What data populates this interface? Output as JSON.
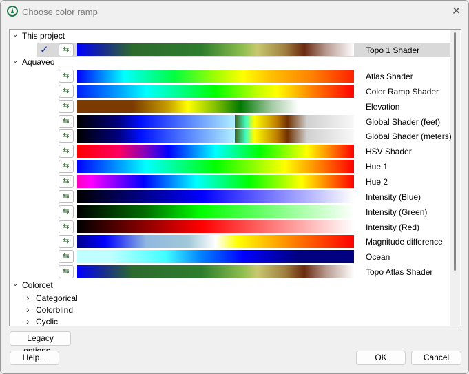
{
  "window": {
    "title": "Choose color ramp",
    "close_icon": "close-icon"
  },
  "tree": {
    "project": {
      "label": "This project",
      "items": [
        {
          "label": "Topo 1 Shader",
          "selected": true,
          "gradient": "linear-gradient(90deg,#0000ff 0%,#1a2f8a 10%,#2d6a2d 20%,#2e7d2e 45%,#8fbf4f 60%,#c8c870 65%,#a08040 75%,#6b2a10 82%,#b89a90 90%,#ffffff 100%)"
        }
      ]
    },
    "aquaveo": {
      "label": "Aquaveo",
      "items": [
        {
          "label": "Atlas Shader",
          "gradient": "linear-gradient(90deg,#0000ff,#00ffff 17%,#00ff40 35%,#a0ff00 50%,#ffff00 60%,#ffc000 70%,#ff8000 85%,#ff2000)"
        },
        {
          "label": "Color Ramp Shader",
          "gradient": "linear-gradient(90deg,#0020ff,#00a0ff 15%,#00ffff 25%,#00ff80 38%,#00ff00 50%,#c0ff00 65%,#ffff00 72%,#ff8000 85%,#ff0000)"
        },
        {
          "label": "Elevation",
          "gradient": "linear-gradient(90deg,#7a3a00 0%,#7a3a00 20%,#c8a000 33%,#ffff00 40%,#80c000 50%,#007800 59%,#a0c8a0 70%,rgba(255,255,255,0) 80%)"
        },
        {
          "label": "Global Shader (feet)",
          "gradient": "linear-gradient(90deg,#000000,#000080 15%,#0010ff 23%,#6090ff 42%,#b0f0ff 57%,#406020 57%,#40ffc0 61%,#ffff00 64%,#c08000 72%,#703000 76%,#d0d0d0 83%,#f8f8f8 100%)"
        },
        {
          "label": "Global Shader (meters)",
          "gradient": "linear-gradient(90deg,#000000,#000080 15%,#0010ff 23%,#6090ff 42%,#b0f0ff 57%,#406020 57%,#40ffc0 61%,#ffff00 64%,#c08000 72%,#703000 76%,#d0d0d0 83%,#f8f8f8 100%)"
        },
        {
          "label": "HSV Shader",
          "gradient": "linear-gradient(90deg,#ff0000,#ff0060 15%,#8000c0 25%,#0000ff 33%,#00ffff 50%,#00ff00 66%,#ffff00 83%,#ff0000)"
        },
        {
          "label": "Hue 1",
          "gradient": "linear-gradient(90deg,#0000ff,#00ffff 25%,#00ff00 50%,#ffff00 75%,#ff0000)"
        },
        {
          "label": "Hue 2",
          "gradient": "linear-gradient(90deg,#ff00c0,#ff00ff 5%,#0000ff 24%,#00ffff 43%,#00ff00 62%,#ffff00 81%,#ff0000)"
        },
        {
          "label": "Intensity (Blue)",
          "gradient": "linear-gradient(90deg,#000000,#000090 25%,#0000ff 45%,#8080ff 72%,#ffffff)"
        },
        {
          "label": "Intensity (Green)",
          "gradient": "linear-gradient(90deg,#000000,#007000 25%,#00ff00 45%,#80ff80 72%,#ffffff)"
        },
        {
          "label": "Intensity (Red)",
          "gradient": "linear-gradient(90deg,#000000,#900000 25%,#ff0000 45%,#ff8080 72%,#ffffff)"
        },
        {
          "label": "Magnitude difference",
          "gradient": "linear-gradient(90deg,#000090,#0000ff 10%,#90b8e0 25%,#a0c8d8 40%,#ffffff 50%,#ffff00 58%,#ff8000 78%,#ff0000)"
        },
        {
          "label": "Ocean",
          "gradient": "linear-gradient(90deg,#c0ffff,#c0ffff 12%,#40ffff 32%,#0080ff 45%,#0000ff 60%,#000080 80%,#000080)"
        },
        {
          "label": "Topo Atlas Shader",
          "gradient": "linear-gradient(90deg,#0000ff 0%,#1a2f8a 10%,#2d6a2d 20%,#2e7d2e 45%,#8fbf4f 60%,#c8c870 65%,#a08040 75%,#6b2a10 82%,#b89a90 90%,#ffffff 100%)"
        }
      ]
    },
    "colorcet": {
      "label": "Colorcet",
      "children": [
        "Categorical",
        "Colorblind",
        "Cyclic"
      ]
    }
  },
  "buttons": {
    "legacy": "Legacy options...",
    "help": "Help...",
    "ok": "OK",
    "cancel": "Cancel"
  },
  "icons": {
    "checked": "✓",
    "reverse": "⇆",
    "expanded": "⌄",
    "collapsed": "›"
  }
}
